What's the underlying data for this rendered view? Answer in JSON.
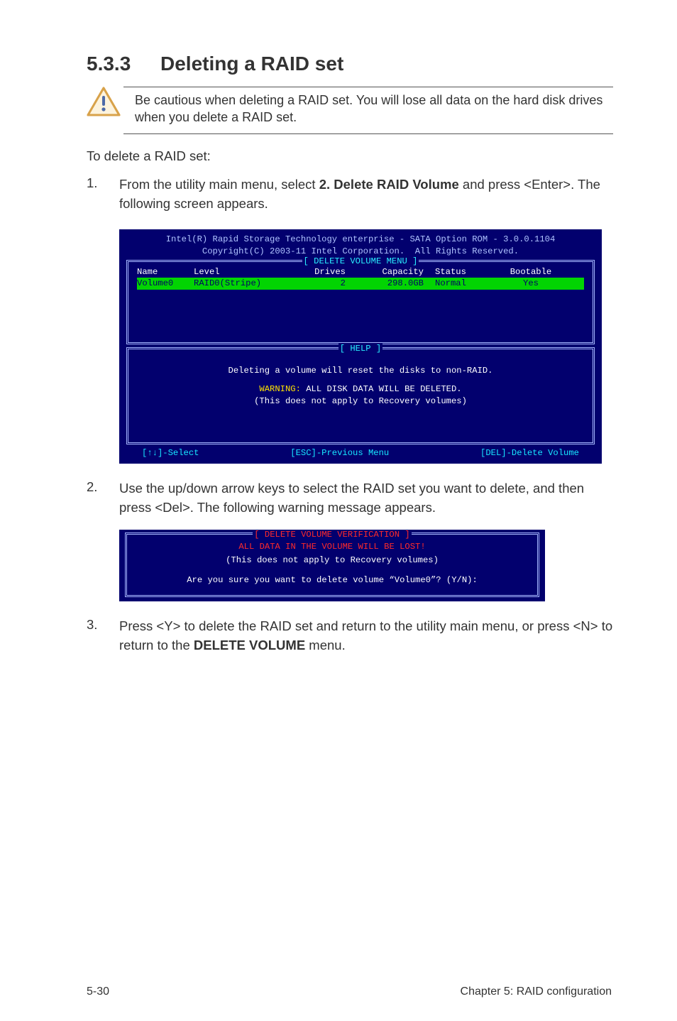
{
  "section": {
    "num": "5.3.3",
    "title": "Deleting a RAID set"
  },
  "note": "Be cautious when deleting a RAID set. You will lose all data on the hard disk drives when you delete a RAID set.",
  "lead": "To delete a RAID set:",
  "steps": {
    "s1": {
      "n": "1.",
      "pre": "From the utility main menu, select ",
      "bold": "2. Delete RAID Volume",
      "post": " and press <Enter>. The following screen appears."
    },
    "s2": {
      "n": "2.",
      "txt": "Use the up/down arrow keys to select the RAID set you want to delete, and then press <Del>. The following warning message appears."
    },
    "s3": {
      "n": "3.",
      "pre": "Press <Y> to delete the RAID set and return to the utility main menu, or press <N> to return to the ",
      "bold": "DELETE VOLUME",
      "post": " menu."
    }
  },
  "bios1": {
    "h1": "Intel(R) Rapid Storage Technology enterprise - SATA Option ROM - 3.0.0.1104",
    "h2": "Copyright(C) 2003-11 Intel Corporation.  All Rights Reserved.",
    "box1_title": "[ DELETE VOLUME MENU ]",
    "th": {
      "name": "Name",
      "level": "Level",
      "drives": "Drives",
      "cap": "Capacity",
      "status": "Status",
      "boot": "Bootable"
    },
    "row": {
      "name": "Volume0",
      "level": "RAID0(Stripe)",
      "drives": "2",
      "cap": "298.0GB",
      "status": "Normal",
      "boot": "Yes"
    },
    "box2_title": "[ HELP ]",
    "help_l1": "Deleting a volume will reset the disks to non-RAID.",
    "help_warn": "WARNING:",
    "help_l2": " ALL DISK DATA WILL BE DELETED.",
    "help_l3": "(This does not apply to Recovery volumes)",
    "f1": "[↑↓]-Select",
    "f2": "[ESC]-Previous Menu",
    "f3": "[DEL]-Delete Volume"
  },
  "bios2": {
    "title": "[ DELETE VOLUME VERIFICATION ]",
    "l1": "ALL DATA IN THE VOLUME WILL BE LOST!",
    "l2": "(This does not apply to Recovery volumes)",
    "l3": "Are you sure you want to delete volume “Volume0”? (Y/N):"
  },
  "footer": {
    "left": "5-30",
    "right": "Chapter 5: RAID configuration"
  }
}
